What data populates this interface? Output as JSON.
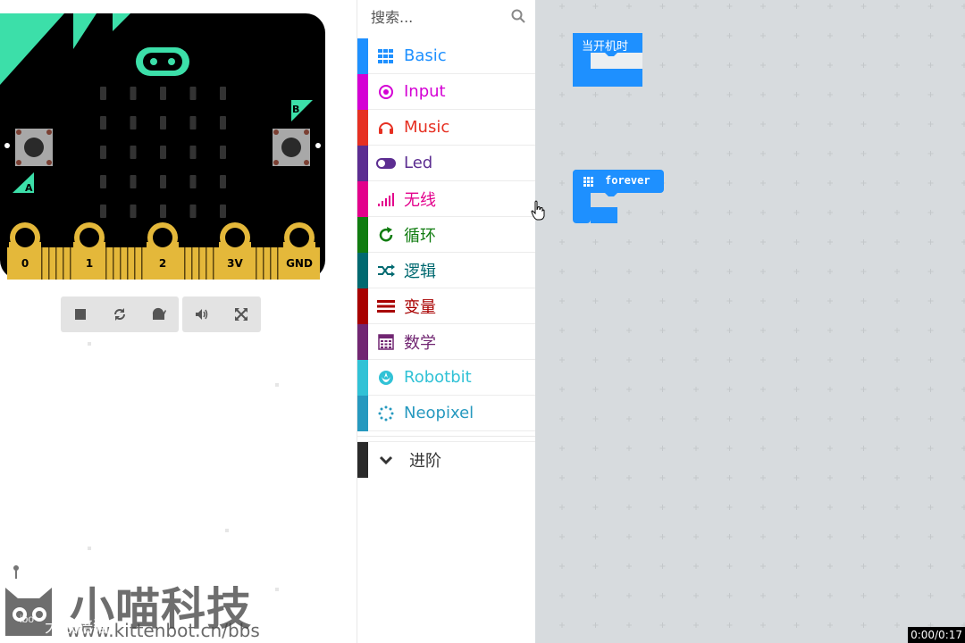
{
  "simulator": {
    "pins": [
      "0",
      "1",
      "2",
      "3V",
      "GND"
    ],
    "button_a": "A",
    "button_b": "B",
    "controls": [
      {
        "name": "stop",
        "icon": "stop-icon"
      },
      {
        "name": "restart",
        "icon": "restart-icon"
      },
      {
        "name": "slow-motion",
        "icon": "snail-icon"
      },
      {
        "name": "mute",
        "icon": "volume-icon"
      },
      {
        "name": "fullscreen",
        "icon": "fullscreen-icon"
      }
    ],
    "colors": {
      "board": "#000000",
      "accent": "#3cdfa9",
      "gold": "#e4b83a",
      "button": "#a8a8a8"
    }
  },
  "toolbox": {
    "search_placeholder": "搜索...",
    "categories": [
      {
        "label": "Basic",
        "color": "#1e90ff",
        "bar": "#1e90ff",
        "icon": "grid-icon"
      },
      {
        "label": "Input",
        "color": "#d400d4",
        "bar": "#d400d4",
        "icon": "target-icon"
      },
      {
        "label": "Music",
        "color": "#e63022",
        "bar": "#e63022",
        "icon": "headphones-icon"
      },
      {
        "label": "Led",
        "color": "#5c2d91",
        "bar": "#5c2d91",
        "icon": "toggle-icon"
      },
      {
        "label": "无线",
        "color": "#e3008c",
        "bar": "#e3008c",
        "icon": "signal-bars-icon"
      },
      {
        "label": "循环",
        "color": "#107c10",
        "bar": "#107c10",
        "icon": "refresh-icon"
      },
      {
        "label": "逻辑",
        "color": "#006970",
        "bar": "#006970",
        "icon": "shuffle-icon"
      },
      {
        "label": "变量",
        "color": "#a80000",
        "bar": "#a80000",
        "icon": "list-icon"
      },
      {
        "label": "数学",
        "color": "#712672",
        "bar": "#712672",
        "icon": "calculator-icon"
      },
      {
        "label": "Robotbit",
        "color": "#31c2d6",
        "bar": "#31c2d6",
        "icon": "rebel-icon"
      },
      {
        "label": "Neopixel",
        "color": "#2699bf",
        "bar": "#2699bf",
        "icon": "circle-dots-icon"
      }
    ],
    "advanced": {
      "label": "进阶",
      "color": "#3c3c3c"
    }
  },
  "workspace": {
    "blocks": [
      {
        "label": "当开机时",
        "color": "#1e90ff"
      },
      {
        "label": "forever",
        "color": "#1e90ff"
      }
    ]
  },
  "watermark": {
    "title": "小喵科技",
    "url": "www.kittenbot.cn/bbs",
    "overlay_text": "大数陪猫",
    "badge": "ibo"
  },
  "video": {
    "time": "0:00/0:17"
  }
}
